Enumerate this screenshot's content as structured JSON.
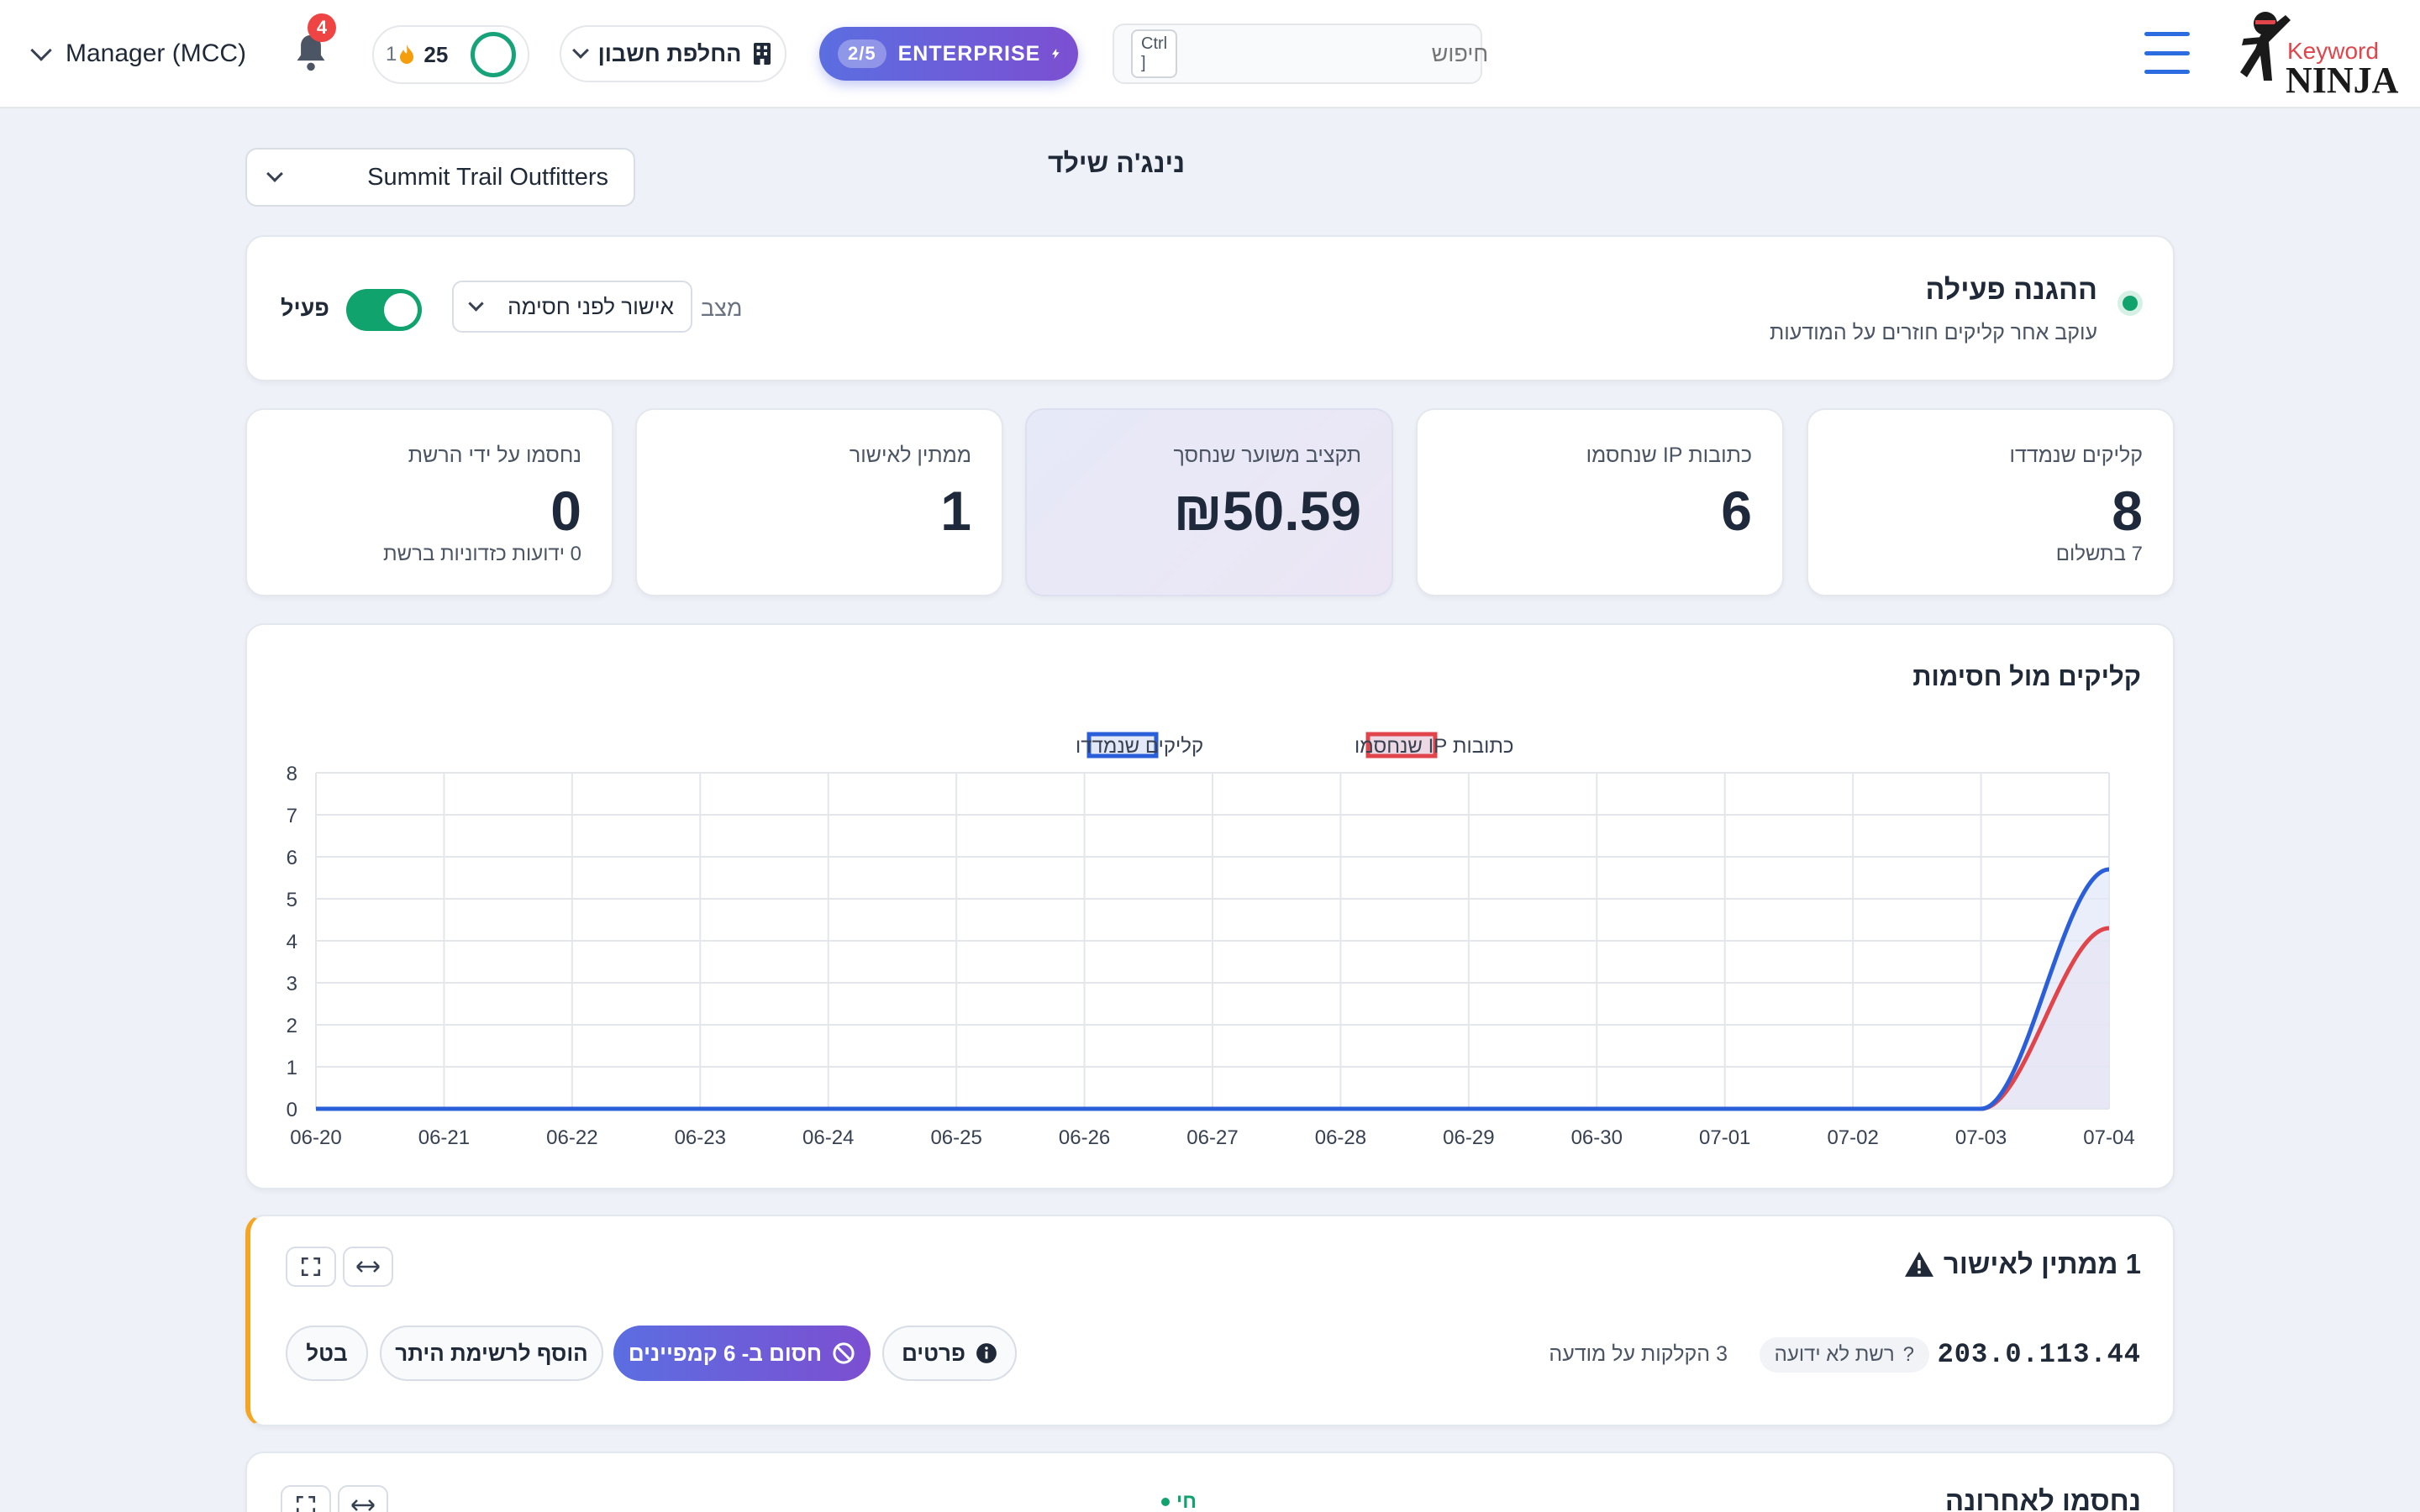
{
  "topbar": {
    "account_menu_label": "Manager (MCC)",
    "notifications_count": "4",
    "credits_value": "25",
    "streak_value": "1",
    "switch_account_label": "החלפת חשבון",
    "plan_usage": "2/5",
    "plan_name": "ENTERPRISE",
    "search_placeholder": "חיפוש",
    "search_shortcut": "Ctrl ]",
    "logo_text_top": "Keyword",
    "logo_text_bottom": "NINJA"
  },
  "page": {
    "title": "נינג'ה שילד",
    "site_selector_value": "Summit Trail Outfitters"
  },
  "protection": {
    "title": "ההגנה פעילה",
    "subtitle": "עוקב אחר קליקים חוזרים על המודעות",
    "mode_label": "מצב",
    "mode_value": "אישור לפני חסימה",
    "toggle_label": "פעיל",
    "enabled": true
  },
  "stats": [
    {
      "label": "קליקים שנמדדו",
      "value": "8",
      "foot": "7 בתשלום"
    },
    {
      "label": "כתובות IP שנחסמו",
      "value": "6",
      "foot": ""
    },
    {
      "label": "תקציב משוער שנחסך",
      "value": "₪50.59",
      "foot": ""
    },
    {
      "label": "ממתין לאישור",
      "value": "1",
      "foot": ""
    },
    {
      "label": "נחסמו על ידי הרשת",
      "value": "0",
      "foot": "0 ידועות כזדוניות ברשת"
    }
  ],
  "chart_data": {
    "type": "area",
    "title": "קליקים מול חסימות",
    "categories": [
      "06-20",
      "06-21",
      "06-22",
      "06-23",
      "06-24",
      "06-25",
      "06-26",
      "06-27",
      "06-28",
      "06-29",
      "06-30",
      "07-01",
      "07-02",
      "07-03",
      "07-04"
    ],
    "series": [
      {
        "name": "קליקים שנמדדו",
        "color": "#2b5fd9",
        "fill": "#e3e8f8",
        "values": [
          0,
          0,
          0,
          0,
          0,
          0,
          0,
          0,
          0,
          0,
          0,
          0,
          0,
          0,
          5.7
        ]
      },
      {
        "name": "כתובות IP שנחסמו",
        "color": "#e0454c",
        "fill": "#ecd9e4",
        "values": [
          0,
          0,
          0,
          0,
          0,
          0,
          0,
          0,
          0,
          0,
          0,
          0,
          0,
          0,
          4.3
        ]
      }
    ],
    "ylim": [
      0,
      8
    ],
    "yticks": [
      "0",
      "1",
      "2",
      "3",
      "4",
      "5",
      "6",
      "7",
      "8"
    ],
    "legend": "top-center",
    "grid": true
  },
  "pending": {
    "title": "1 ממתין לאישור",
    "ip": "203.0.113.44",
    "network_badge": "רשת לא ידועה",
    "network_badge_icon": "?",
    "clicks_note": "3 הקלקות על מודעה",
    "details_label": "פרטים",
    "block_label": "חסום ב- 6 קמפיינים",
    "allowlist_label": "הוסף לרשימת היתר",
    "cancel_label": "בטל"
  },
  "recent": {
    "title": "נחסמו לאחרונה",
    "live_label": "חי"
  }
}
